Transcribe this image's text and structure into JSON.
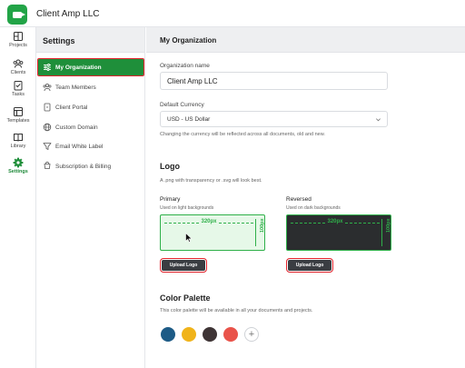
{
  "topbar": {
    "company_name": "Client Amp LLC"
  },
  "rail": [
    {
      "label": "Projects",
      "icon": "projects-icon"
    },
    {
      "label": "Clients",
      "icon": "clients-icon"
    },
    {
      "label": "Tasks",
      "icon": "tasks-icon"
    },
    {
      "label": "Templates",
      "icon": "templates-icon"
    },
    {
      "label": "Library",
      "icon": "library-icon"
    },
    {
      "label": "Settings",
      "icon": "gear-icon",
      "active": true
    }
  ],
  "settings": {
    "title": "Settings",
    "items": [
      {
        "label": "My Organization",
        "icon": "sliders-icon",
        "active": true
      },
      {
        "label": "Team Members",
        "icon": "team-icon"
      },
      {
        "label": "Client Portal",
        "icon": "portal-icon"
      },
      {
        "label": "Custom Domain",
        "icon": "globe-icon"
      },
      {
        "label": "Email White Label",
        "icon": "email-funnel-icon"
      },
      {
        "label": "Subscription & Billing",
        "icon": "billing-icon"
      }
    ]
  },
  "main": {
    "title": "My Organization",
    "org_name_label": "Organization name",
    "org_name_value": "Client Amp LLC",
    "currency_label": "Default Currency",
    "currency_value": "USD - US Dollar",
    "currency_hint": "Changing the currency will be reflected across all documents, old and new.",
    "logo": {
      "title": "Logo",
      "hint": "A .png with transparency or .svg will look best.",
      "primary_title": "Primary",
      "primary_sub": "Used on light backgrounds",
      "reversed_title": "Reversed",
      "reversed_sub": "Used on dark backgrounds",
      "width_label": "320px",
      "height_label": "100px",
      "upload_label": "Upload Logo"
    },
    "palette": {
      "title": "Color Palette",
      "hint": "This color palette will be available in all your documents and projects.",
      "colors": [
        "#1d5b86",
        "#f0b31a",
        "#3e3435",
        "#e9534a"
      ],
      "add_label": "+"
    }
  },
  "colors": {
    "accent_green": "#1f8f3a",
    "highlight_red": "#e3232c"
  }
}
